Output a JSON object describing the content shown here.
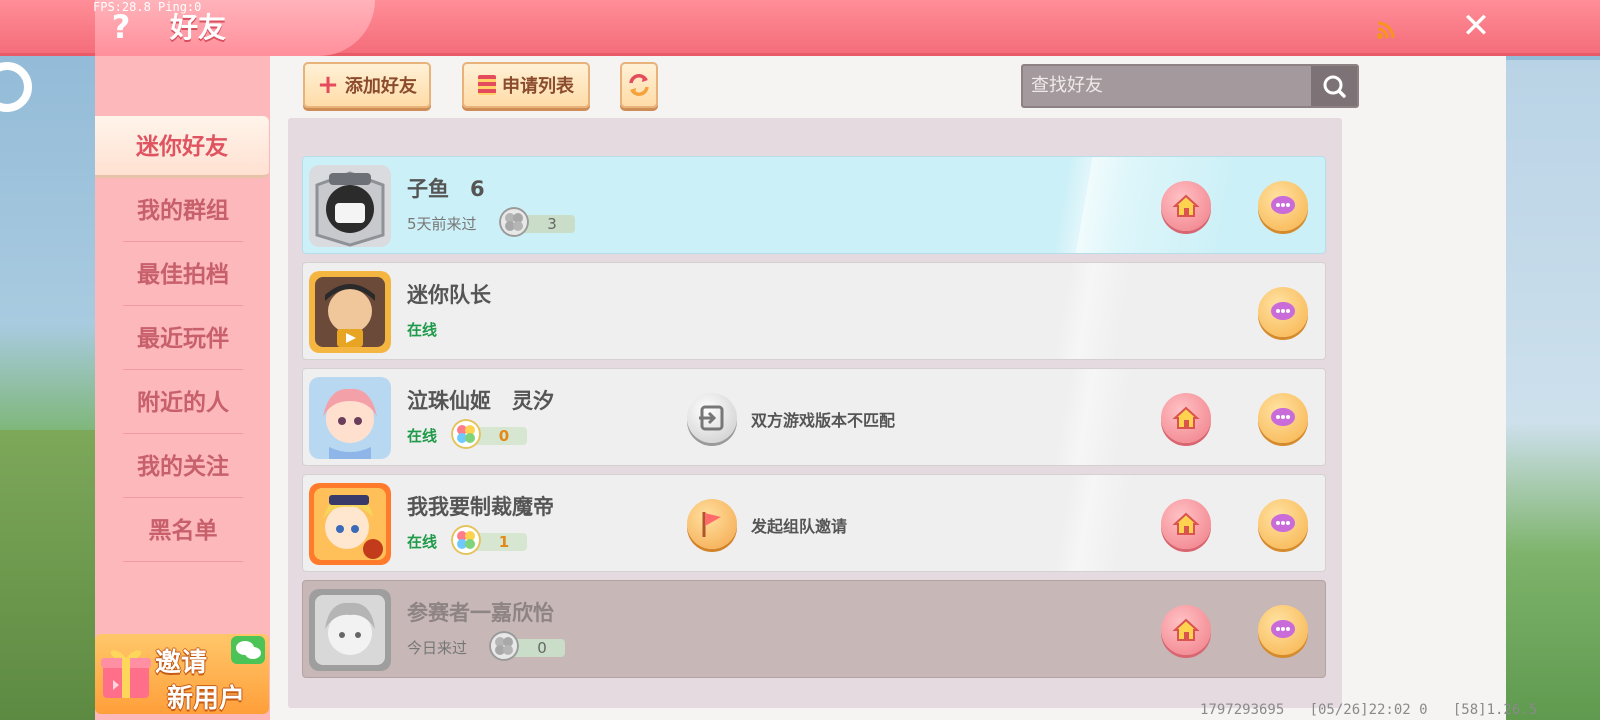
{
  "topbar": {
    "fps_text": "FPS:28.8  Ping:0",
    "title": "好友",
    "help_glyph": "?",
    "close_glyph": "✕"
  },
  "sidebar": {
    "items": [
      {
        "label": "迷你好友",
        "active": true
      },
      {
        "label": "我的群组",
        "active": false
      },
      {
        "label": "最佳拍档",
        "active": false
      },
      {
        "label": "最近玩伴",
        "active": false
      },
      {
        "label": "附近的人",
        "active": false
      },
      {
        "label": "我的关注",
        "active": false
      },
      {
        "label": "黑名单",
        "active": false
      }
    ],
    "invite": {
      "line1": "邀请",
      "line2": "新用户"
    }
  },
  "toolbar": {
    "add_friend": "添加好友",
    "apply_list": "申请列表",
    "search_placeholder": "查找好友"
  },
  "friends": [
    {
      "name": "子鱼　6",
      "status": "5天前来过",
      "level": "3",
      "online": false,
      "highlight": true,
      "note": "",
      "has_home": true
    },
    {
      "name": "迷你队长",
      "status": "在线",
      "level": "",
      "online": true,
      "highlight": false,
      "note": "",
      "has_home": false
    },
    {
      "name": "泣珠仙姬　灵汐",
      "status": "在线",
      "level": "0",
      "online": true,
      "highlight": false,
      "note": "双方游戏版本不匹配",
      "has_home": true
    },
    {
      "name": "我我要制裁魔帝",
      "status": "在线",
      "level": "1",
      "online": true,
      "highlight": false,
      "note": "发起组队邀请",
      "has_home": true
    },
    {
      "name": "参赛者一嘉欣怡",
      "status": "今日来过",
      "level": "0",
      "online": false,
      "highlight": false,
      "offline_style": true,
      "note": "",
      "has_home": true
    }
  ],
  "footer": {
    "info": "1797293695   [05/26]22:02 0   [58]1.26.5"
  },
  "colors": {
    "topbar": "#f46d7a",
    "sidebar": "#fdb8bc",
    "online_green": "#1f9a4a",
    "highlight_row": "#ccf0f7"
  }
}
